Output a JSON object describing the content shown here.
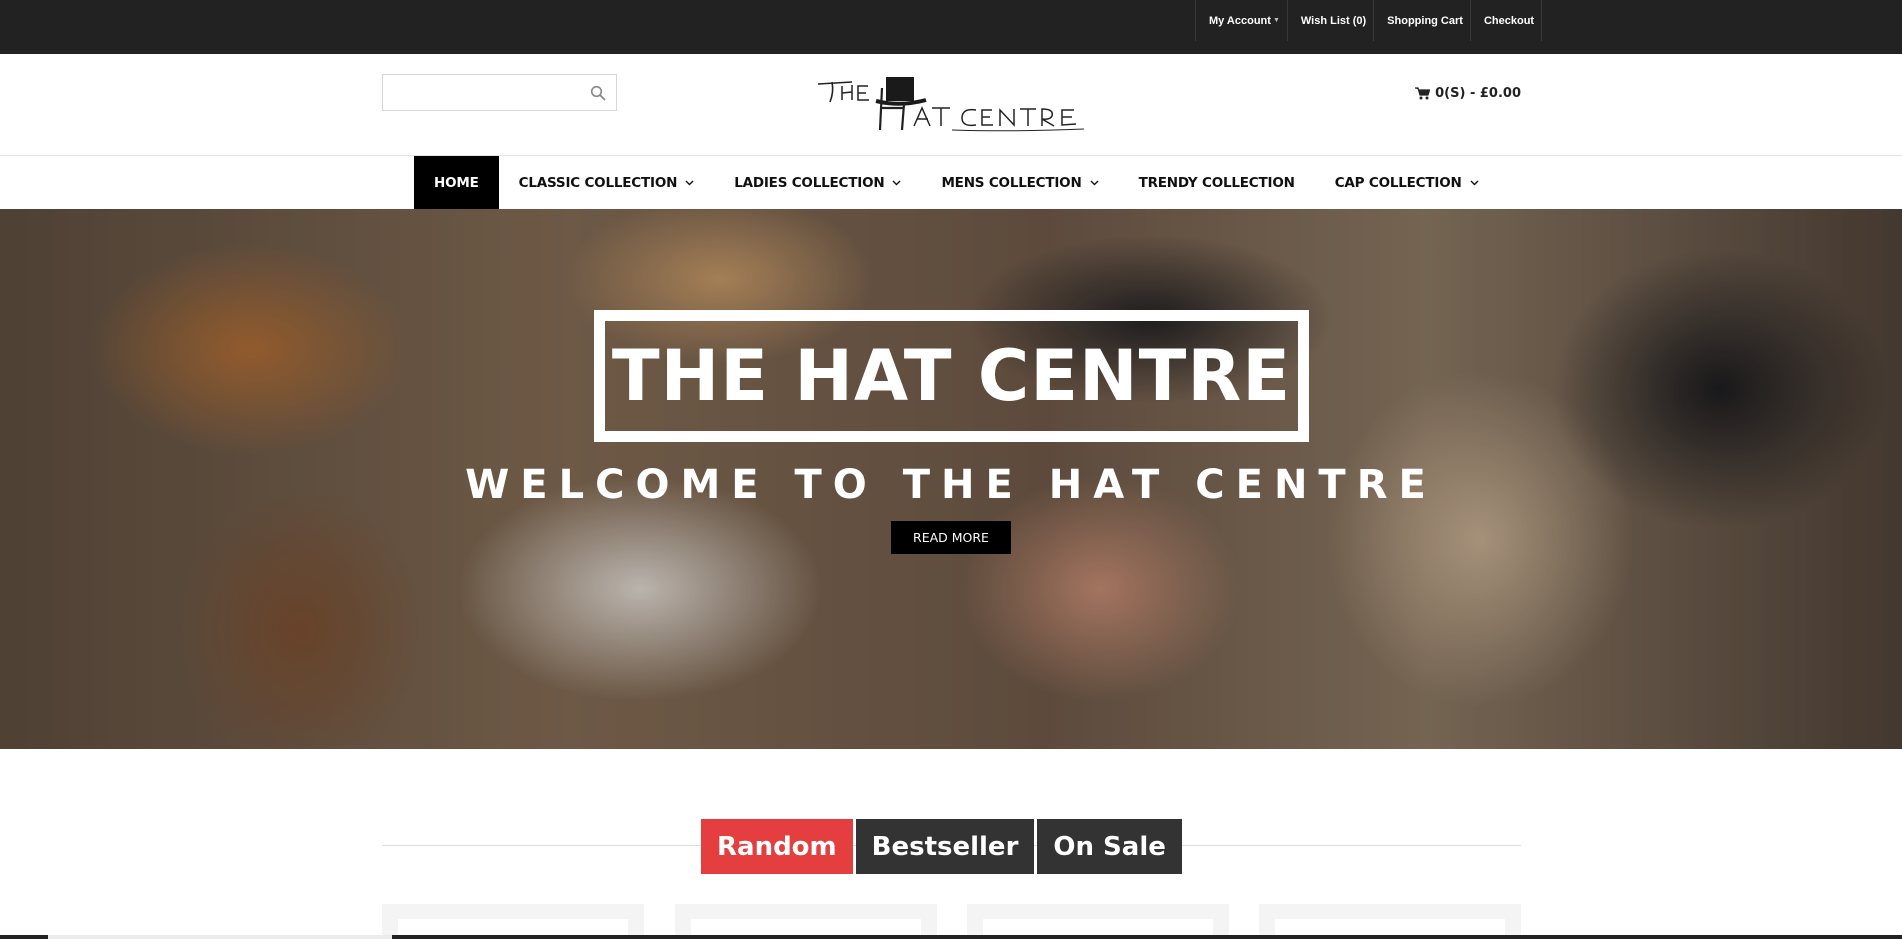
{
  "topbar": {
    "links": [
      {
        "label": "My Account",
        "has_caret": true
      },
      {
        "label": "Wish List (0)"
      },
      {
        "label": "Shopping Cart"
      },
      {
        "label": "Checkout"
      }
    ]
  },
  "header": {
    "search": {
      "placeholder": "",
      "icon": "search-icon"
    },
    "logo_text": "THE HAT CENTRE",
    "cart_label": "0(S) - £0.00",
    "cart_icon": "cart-icon"
  },
  "nav": {
    "items": [
      {
        "label": "HOME",
        "active": true
      },
      {
        "label": "CLASSIC COLLECTION",
        "dropdown": true
      },
      {
        "label": "LADIES COLLECTION",
        "dropdown": true
      },
      {
        "label": "MENS COLLECTION",
        "dropdown": true
      },
      {
        "label": "TRENDY COLLECTION"
      },
      {
        "label": "CAP COLLECTION",
        "dropdown": true
      }
    ]
  },
  "hero": {
    "title": "THE HAT CENTRE",
    "subtitle": "WELCOME TO THE HAT CENTRE",
    "button_label": "READ MORE"
  },
  "product_tabs": [
    {
      "label": "Random",
      "active": true
    },
    {
      "label": "Bestseller"
    },
    {
      "label": "On Sale"
    }
  ],
  "colors": {
    "topbar": "#222222",
    "accent_red": "#e53e3e",
    "tab_dark": "#333333",
    "nav_active": "#000000"
  }
}
